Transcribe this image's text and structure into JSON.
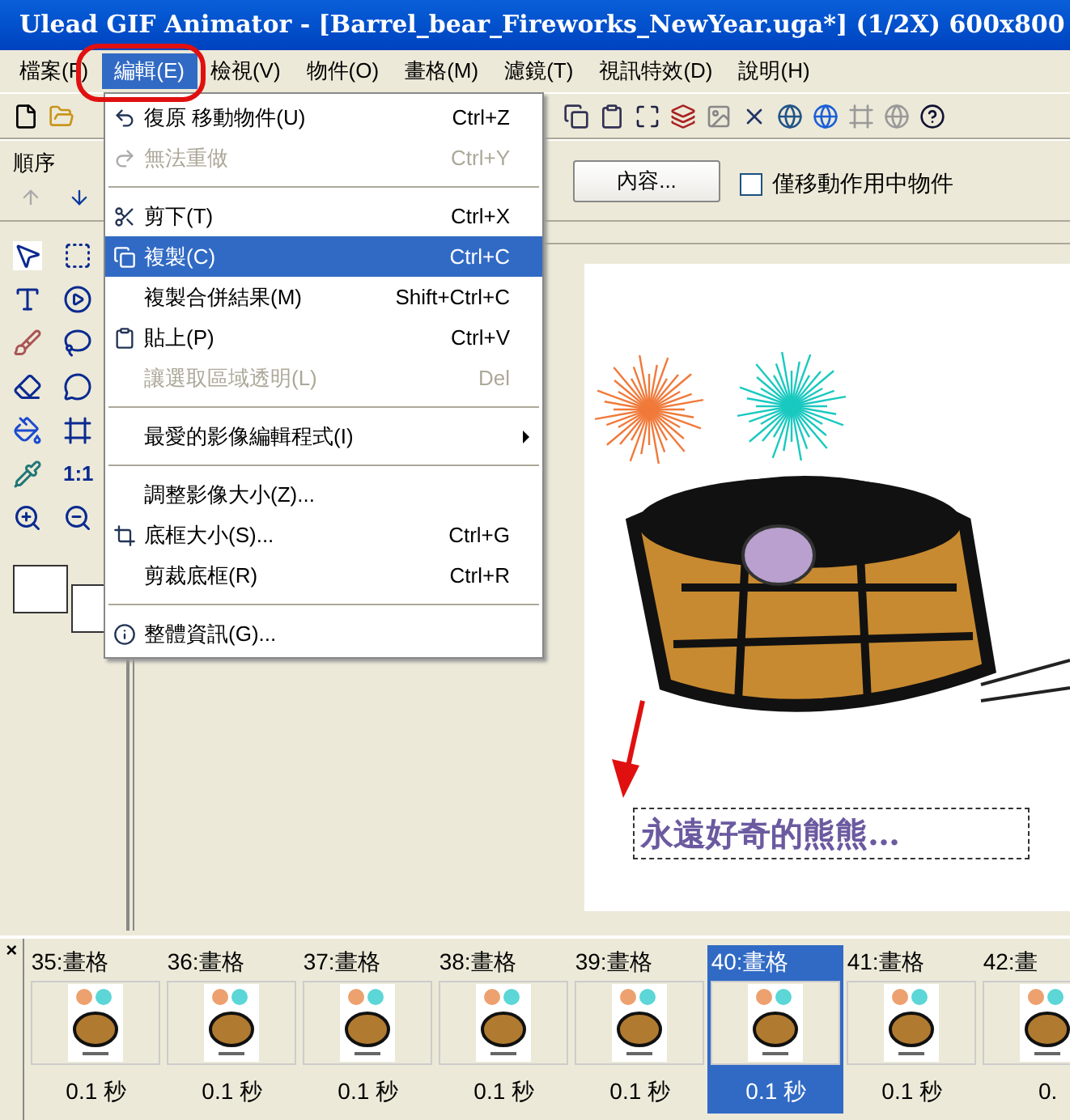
{
  "window": {
    "title": "Ulead GIF Animator - [Barrel_bear_Fireworks_NewYear.uga*] (1/2X)  600x800"
  },
  "menubar": [
    {
      "label": "檔案(F)",
      "selected": false
    },
    {
      "label": "編輯(E)",
      "selected": true
    },
    {
      "label": "檢視(V)",
      "selected": false
    },
    {
      "label": "物件(O)",
      "selected": false
    },
    {
      "label": "畫格(M)",
      "selected": false
    },
    {
      "label": "濾鏡(T)",
      "selected": false
    },
    {
      "label": "視訊特效(D)",
      "selected": false
    },
    {
      "label": "說明(H)",
      "selected": false
    }
  ],
  "order_panel": {
    "title": "順序"
  },
  "properties_button": "內容...",
  "move_active_only": {
    "label": "僅移動作用中物件",
    "checked": false
  },
  "tool_labels": [
    "1:1"
  ],
  "edit_menu": [
    {
      "kind": "item",
      "label": "復原 移動物件(U)",
      "shortcut": "Ctrl+Z",
      "disabled": false,
      "selected": false
    },
    {
      "kind": "item",
      "label": "無法重做",
      "shortcut": "Ctrl+Y",
      "disabled": true,
      "selected": false
    },
    {
      "kind": "separator"
    },
    {
      "kind": "item",
      "label": "剪下(T)",
      "shortcut": "Ctrl+X",
      "disabled": false,
      "selected": false
    },
    {
      "kind": "item",
      "label": "複製(C)",
      "shortcut": "Ctrl+C",
      "disabled": false,
      "selected": true
    },
    {
      "kind": "item",
      "label": "複製合併結果(M)",
      "shortcut": "Shift+Ctrl+C",
      "disabled": false,
      "selected": false
    },
    {
      "kind": "item",
      "label": "貼上(P)",
      "shortcut": "Ctrl+V",
      "disabled": false,
      "selected": false
    },
    {
      "kind": "item",
      "label": "讓選取區域透明(L)",
      "shortcut": "Del",
      "disabled": true,
      "selected": false
    },
    {
      "kind": "separator"
    },
    {
      "kind": "item",
      "label": "最愛的影像編輯程式(I)",
      "submenu": true,
      "disabled": false,
      "selected": false
    },
    {
      "kind": "separator"
    },
    {
      "kind": "item",
      "label": "調整影像大小(Z)...",
      "disabled": false,
      "selected": false
    },
    {
      "kind": "item",
      "label": "底框大小(S)...",
      "shortcut": "Ctrl+G",
      "disabled": false,
      "selected": false
    },
    {
      "kind": "item",
      "label": "剪裁底框(R)",
      "shortcut": "Ctrl+R",
      "disabled": false,
      "selected": false
    },
    {
      "kind": "separator"
    },
    {
      "kind": "item",
      "label": "整體資訊(G)...",
      "disabled": false,
      "selected": false
    }
  ],
  "canvas_text": "永遠好奇的熊熊…",
  "frames_panel": {
    "close": "×"
  },
  "frames": [
    {
      "label": "35:畫格",
      "delay": "0.1 秒",
      "selected": false
    },
    {
      "label": "36:畫格",
      "delay": "0.1 秒",
      "selected": false
    },
    {
      "label": "37:畫格",
      "delay": "0.1 秒",
      "selected": false
    },
    {
      "label": "38:畫格",
      "delay": "0.1 秒",
      "selected": false
    },
    {
      "label": "39:畫格",
      "delay": "0.1 秒",
      "selected": false
    },
    {
      "label": "40:畫格",
      "delay": "0.1 秒",
      "selected": true
    },
    {
      "label": "41:畫格",
      "delay": "0.1 秒",
      "selected": false
    },
    {
      "label": "42:畫",
      "delay": "0.",
      "selected": false
    }
  ]
}
